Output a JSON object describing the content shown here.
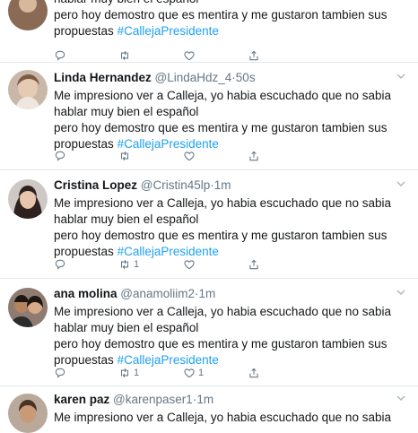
{
  "tweets": [
    {
      "lines": [
        "habiar muy bien el español"
      ],
      "line2": "pero hoy demostro que es mentira y me gustaron tambien sus",
      "line3_text": "propuestas",
      "hashtag": "#CallejaPresidente"
    },
    {
      "name": "Linda Hernandez",
      "handle": "@LindaHdz_4",
      "time": "50s",
      "line1": "Me impresiono ver a Calleja, yo habia escuchado que no sabia",
      "line2": "hablar muy bien el español",
      "line3": "pero hoy demostro que es mentira y me gustaron tambien sus",
      "line4_text": "propuestas",
      "hashtag": "#CallejaPresidente",
      "retweets": "",
      "likes": ""
    },
    {
      "name": "Cristina Lopez",
      "handle": "@Cristin45lp",
      "time": "1m",
      "line1": "Me impresiono ver a Calleja, yo habia escuchado que no sabia",
      "line2": "hablar muy bien el español",
      "line3": "pero hoy demostro que es mentira y me gustaron tambien sus",
      "line4_text": "propuestas",
      "hashtag": "#CallejaPresidente",
      "retweets": "1",
      "likes": ""
    },
    {
      "name": "ana molina",
      "handle": "@anamoliim2",
      "time": "1m",
      "line1": "Me impresiono ver a Calleja, yo habia escuchado que no sabia",
      "line2": "hablar muy bien el español",
      "line3": "pero hoy demostro que es mentira y me gustaron tambien sus",
      "line4_text": "propuestas",
      "hashtag": "#CallejaPresidente",
      "retweets": "1",
      "likes": "1"
    },
    {
      "name": "karen paz",
      "handle": "@karenpaser1",
      "time": "1m",
      "line1": "Me impresiono ver a Calleja, yo habia escuchado que no sabia"
    }
  ],
  "separator": "·",
  "icons": [
    "reply-icon",
    "retweet-icon",
    "like-icon",
    "share-icon",
    "chevron-down-icon"
  ],
  "colors": {
    "link": "#1da1f2",
    "muted": "#657786",
    "divider": "#e1e8ed"
  }
}
